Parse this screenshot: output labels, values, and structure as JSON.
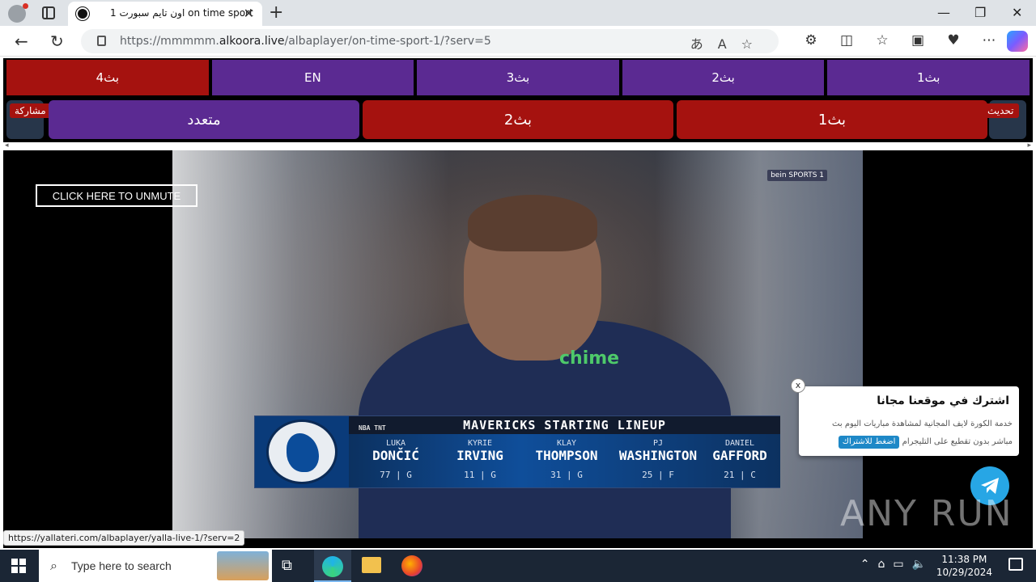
{
  "browser": {
    "tab_title": "اون تايم سبورت 1 on time sport",
    "tab_close": "✕",
    "new_tab": "+",
    "url_host_prefix": "https://mmmmm.",
    "url_host": "alkoora.live",
    "url_path": "/albaplayer/on-time-sport-1/?serv=5",
    "window_controls": {
      "minimize": "—",
      "maximize": "❐",
      "close": "✕"
    },
    "nav": {
      "back": "←",
      "refresh": "↻"
    }
  },
  "servers": {
    "row1": [
      {
        "label": "بث4",
        "color": "#a5120f"
      },
      {
        "label": "EN",
        "color": "#5b2a92"
      },
      {
        "label": "بث3",
        "color": "#5b2a92"
      },
      {
        "label": "بث2",
        "color": "#5b2a92"
      },
      {
        "label": "بث1",
        "color": "#5b2a92"
      }
    ],
    "row2": [
      {
        "label": "متعدد",
        "color": "#5b2a92"
      },
      {
        "label": "بث2",
        "color": "#a5120f"
      },
      {
        "label": "بث1",
        "color": "#a5120f"
      }
    ],
    "share_label": "مشاركة",
    "refresh_label": "تحديث"
  },
  "video": {
    "unmute_label": "CLICK HERE TO UNMUTE",
    "network_badge": "bein SPORTS 1",
    "sponsor": "chime",
    "lineup": {
      "title": "MAVERICKS STARTING LINEUP",
      "league_mark": "NBA TNT",
      "players": [
        {
          "first": "LUKA",
          "last": "DONČIĆ",
          "number": "77",
          "pos": "G"
        },
        {
          "first": "KYRIE",
          "last": "IRVING",
          "number": "11",
          "pos": "G"
        },
        {
          "first": "KLAY",
          "last": "THOMPSON",
          "number": "31",
          "pos": "G"
        },
        {
          "first": "PJ",
          "last": "WASHINGTON",
          "number": "25",
          "pos": "F"
        },
        {
          "first": "DANIEL",
          "last": "GAFFORD",
          "number": "21",
          "pos": "C"
        }
      ]
    }
  },
  "popup": {
    "title": "اشترك في موقعنا مجانا",
    "line1": "خدمة الكورة لايف المجانية لمشاهدة مباريات اليوم بث",
    "line2": "مباشر بدون تقطيع على التليجرام",
    "button": "اضغط للاشتراك",
    "close": "x"
  },
  "watermark": "ANY RUN",
  "status_link": "https://yallateri.com/albaplayer/yalla-live-1/?serv=2",
  "taskbar": {
    "search_placeholder": "Type here to search",
    "time": "11:38 PM",
    "date": "10/29/2024"
  },
  "colors": {
    "purple": "#5b2a92",
    "red": "#a5120f",
    "telegram": "#27a6e5"
  }
}
